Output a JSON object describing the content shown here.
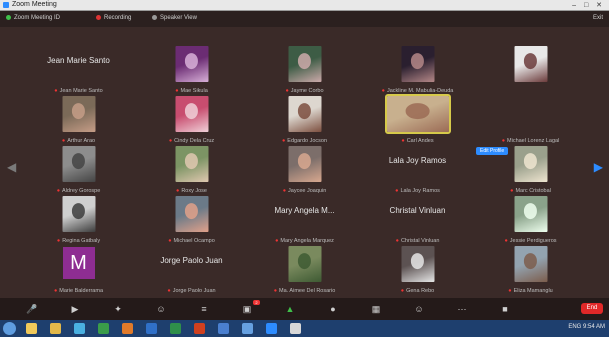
{
  "window": {
    "title": "Zoom Meeting"
  },
  "meeting_bar": {
    "items": [
      {
        "label": "Zoom Meeting ID",
        "color": "#3fbf4a"
      },
      {
        "label": "Recording",
        "color": "#d33"
      },
      {
        "label": "Speaker View",
        "color": "#999"
      }
    ],
    "right_label": "Exit"
  },
  "participants": [
    {
      "label": "Jean Marie Santo",
      "big_name": "Jean Marie Santo",
      "video": "none"
    },
    {
      "label": "Mae Sikula",
      "video": "avatar",
      "colors": [
        "#6b2c73",
        "#d8b0d8"
      ]
    },
    {
      "label": "Jayme Corbo",
      "video": "cam",
      "colors": [
        "#3d5c45",
        "#caa"
      ]
    },
    {
      "label": "Jackline M. Mabulia-Deuda",
      "video": "cam",
      "colors": [
        "#2a1f2f",
        "#b58888"
      ]
    },
    {
      "label": "",
      "video": "cam",
      "colors": [
        "#e8e8e8",
        "#6b3b3b"
      ]
    },
    {
      "label": "Arthur Arao",
      "video": "cam",
      "colors": [
        "#7b6a58",
        "#c69d87"
      ]
    },
    {
      "label": "Cindy Dela Cruz",
      "video": "cam",
      "colors": [
        "#c84d6f",
        "#f0d0d8"
      ]
    },
    {
      "label": "Edgardo Jocson",
      "video": "cam",
      "colors": [
        "#ddd7cf",
        "#7d4f3f"
      ]
    },
    {
      "label": "Carl Andes",
      "video": "cam",
      "colors": [
        "#c8b08e",
        "#9b6b55"
      ],
      "active": true
    },
    {
      "label": "Michael Lorenz Lagal",
      "video": "none"
    },
    {
      "label": "Aldrey Gorospe",
      "video": "cam",
      "colors": [
        "#8d8d8d",
        "#444"
      ]
    },
    {
      "label": "Roxy Jose",
      "video": "cam",
      "colors": [
        "#7c9464",
        "#e0c8b0"
      ]
    },
    {
      "label": "Jaycee Joaquin",
      "video": "cam",
      "colors": [
        "#7c6e6a",
        "#d8a88f"
      ]
    },
    {
      "label": "Lala Joy Ramos",
      "big_name": "Lala Joy Ramos",
      "video": "none"
    },
    {
      "label": "Marc Cristobal",
      "video": "cam",
      "colors": [
        "#9aa08c",
        "#efe5d0"
      ]
    },
    {
      "label": "Regina Gatbaly",
      "video": "cam",
      "colors": [
        "#cfcfcf",
        "#3c3c3c"
      ]
    },
    {
      "label": "Michael Ocampo",
      "video": "cam",
      "colors": [
        "#6b7a88",
        "#e1a18a"
      ]
    },
    {
      "label": "Mary Angela Marquez",
      "big_name": "Mary Angela M...",
      "video": "none"
    },
    {
      "label": "Christal Vinluan",
      "big_name": "Christal Vinluan",
      "video": "none"
    },
    {
      "label": "Jessie Perdigueros",
      "video": "cam",
      "colors": [
        "#8aa28a",
        "#efe"
      ]
    },
    {
      "label": "Marie Balderrama",
      "video": "letter",
      "letter": "M"
    },
    {
      "label": "Jorge Paolo Juan",
      "big_name": "Jorge Paolo Juan",
      "video": "none"
    },
    {
      "label": "Ma. Aimee Del Rosario",
      "video": "cam",
      "colors": [
        "#7a8a5e",
        "#3e5a33"
      ]
    },
    {
      "label": "Gena Rebo",
      "video": "cam",
      "colors": [
        "#5c5252",
        "#e6e6e6"
      ]
    },
    {
      "label": "Eliza Mamanglu",
      "video": "cam",
      "colors": [
        "#93a3b0",
        "#7c5d4c"
      ]
    }
  ],
  "hover_chip": "Edit Profile",
  "toolbar": {
    "icons": [
      "mute-icon",
      "video-icon",
      "security-icon",
      "participants-icon",
      "polls-icon",
      "chat-icon",
      "share-screen-icon",
      "record-icon",
      "gallery-view-icon",
      "reactions-icon",
      "more-icon",
      "apps-icon"
    ],
    "chat_badge": "2",
    "end_label": "End"
  },
  "taskbar": {
    "tray_text": "ENG 9:54 AM",
    "apps": [
      {
        "name": "ie",
        "color": "#f0c95a"
      },
      {
        "name": "explorer",
        "color": "#e2b84a"
      },
      {
        "name": "media",
        "color": "#4ab0e0"
      },
      {
        "name": "chrome",
        "color": "#3a9c4a"
      },
      {
        "name": "camera",
        "color": "#e07a2a"
      },
      {
        "name": "word",
        "color": "#3070c8"
      },
      {
        "name": "excel",
        "color": "#2f8f4a"
      },
      {
        "name": "ppt",
        "color": "#d0401f"
      },
      {
        "name": "app1",
        "color": "#4a7fcf"
      },
      {
        "name": "app2",
        "color": "#66a0e0"
      },
      {
        "name": "zoom",
        "color": "#2d8cff"
      },
      {
        "name": "app3",
        "color": "#d8d8d8"
      }
    ]
  }
}
